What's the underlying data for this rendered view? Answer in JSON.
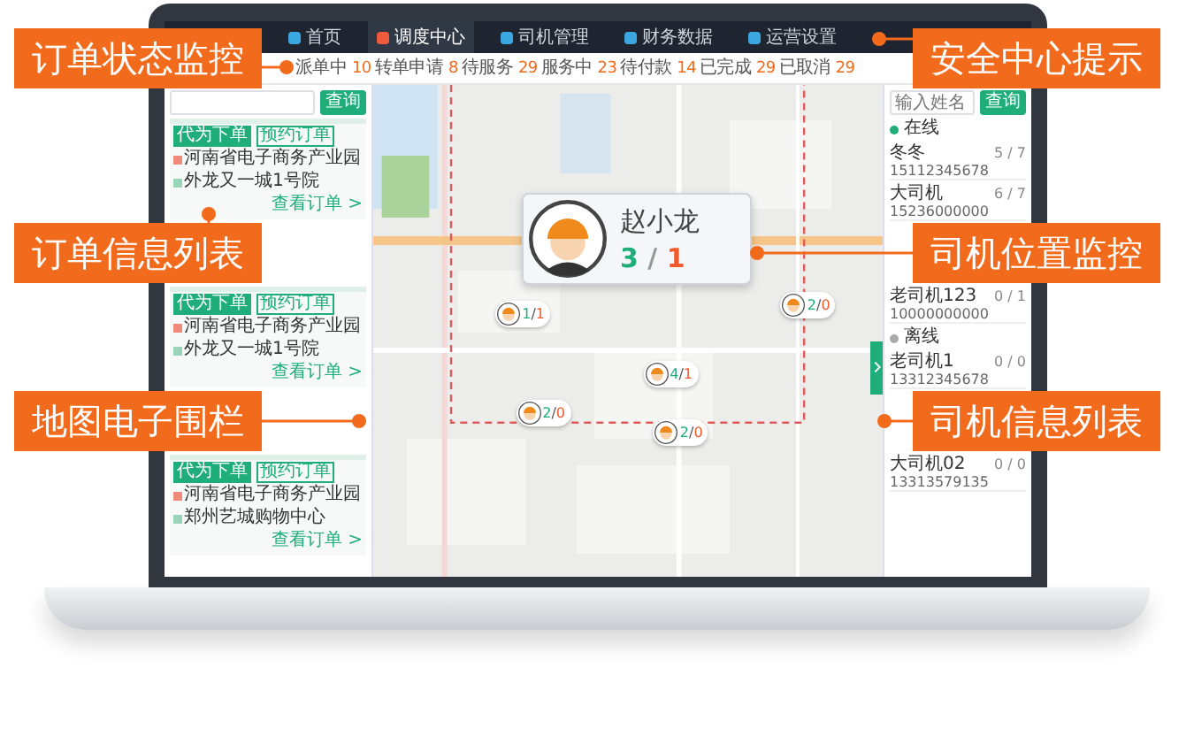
{
  "nav": {
    "items": [
      {
        "label": "首页",
        "selected": false
      },
      {
        "label": "调度中心",
        "selected": true
      },
      {
        "label": "司机管理",
        "selected": false
      },
      {
        "label": "财务数据",
        "selected": false
      },
      {
        "label": "运营设置",
        "selected": false
      }
    ]
  },
  "status_tabs": [
    {
      "label": "派单中",
      "count": "10",
      "selected": false
    },
    {
      "label": "转单申请",
      "count": "8",
      "selected": false
    },
    {
      "label": "待服务",
      "count": "29",
      "selected": false
    },
    {
      "label": "服务中",
      "count": "23",
      "selected": false
    },
    {
      "label": "待付款",
      "count": "14",
      "selected": false
    },
    {
      "label": "已完成",
      "count": "29",
      "selected": false
    },
    {
      "label": "已取消",
      "count": "29",
      "selected": false
    }
  ],
  "order_panel": {
    "search_button": "查询",
    "orders": [
      {
        "tags": [
          "代为下单",
          "预约订单"
        ],
        "from": "河南省电子商务产业园",
        "to": "外龙又一城1号院",
        "link": "查看订单 >"
      },
      {
        "tags": [
          "代为下单",
          "预约订单"
        ],
        "from": "河南省电子商务产业园",
        "to": "外龙又一城1号院",
        "link": "查看订单 >"
      },
      {
        "tags": [
          "代为下单",
          "预约订单"
        ],
        "from": "河南省电子商务产业园",
        "to": "郑州艺城购物中心",
        "link": "查看订单 >"
      }
    ]
  },
  "map": {
    "count_separator": "/",
    "popup": {
      "name": "赵小龙",
      "done": "3",
      "pending": "1"
    },
    "markers": [
      {
        "done": "1",
        "pending": "1"
      },
      {
        "done": "2",
        "pending": "0"
      },
      {
        "done": "4",
        "pending": "1"
      },
      {
        "done": "2",
        "pending": "0"
      },
      {
        "done": "2",
        "pending": "0"
      }
    ]
  },
  "driver_panel": {
    "search_placeholder": "输入姓名",
    "search_button": "查询",
    "groups": [
      {
        "label": "在线",
        "online": true,
        "drivers": [
          {
            "name": "冬冬",
            "phone": "15112345678",
            "count": "5 / 7"
          },
          {
            "name": "大司机",
            "phone": "15236000000",
            "count": "6 / 7"
          },
          {
            "name": "老司机123",
            "phone": "10000000000",
            "count": "0 / 1"
          }
        ]
      },
      {
        "label": "离线",
        "online": false,
        "drivers": [
          {
            "name": "老司机1",
            "phone": "13312345678",
            "count": "0 / 0"
          },
          {
            "name": "大司机02",
            "phone": "13313579135",
            "count": "0 / 0"
          }
        ]
      }
    ]
  },
  "callouts": [
    {
      "label": "订单状态监控"
    },
    {
      "label": "安全中心提示"
    },
    {
      "label": "订单信息列表"
    },
    {
      "label": "司机位置监控"
    },
    {
      "label": "地图电子围栏"
    },
    {
      "label": "司机信息列表"
    }
  ]
}
